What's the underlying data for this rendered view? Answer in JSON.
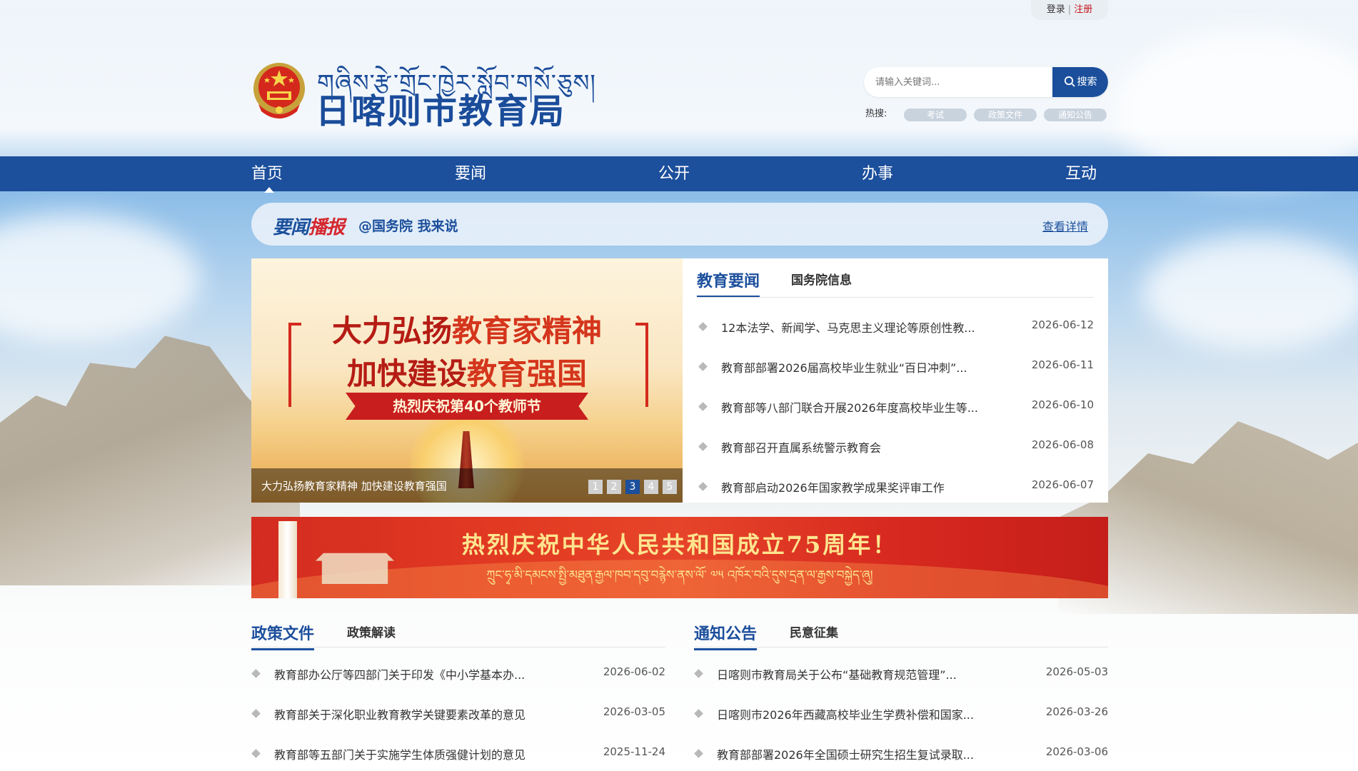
{
  "topbar": {
    "login": "登录",
    "separator": "|",
    "register": "注册"
  },
  "header": {
    "tibetan_name": "གཞིས་རྩེ་གྲོང་ཁྱེར་སློབ་གསོ་ཅུས།",
    "site_name": "日喀则市教育局",
    "search_placeholder": "请输入关键词...",
    "search_button": "搜索",
    "hot_label": "热搜:",
    "hot_tags": [
      "考试",
      "政策文件",
      "通知公告"
    ]
  },
  "nav": [
    "首页",
    "要闻",
    "公开",
    "办事",
    "互动"
  ],
  "ticker": {
    "logo_part1": "要闻",
    "logo_part2": "播报",
    "text": "@国务院 我来说",
    "more": "查看详情"
  },
  "slider": {
    "line1_a": "大力弘扬",
    "line1_b": "教育家精神",
    "line2_a": "加快建设",
    "line2_b": "教育强国",
    "ribbon": "热烈庆祝第40个教师节",
    "caption": "大力弘扬教育家精神 加快建设教育强国",
    "pages": [
      "1",
      "2",
      "3",
      "4",
      "5"
    ],
    "active_page": 3
  },
  "news_panel": {
    "tabs": [
      "教育要闻",
      "国务院信息"
    ],
    "items": [
      {
        "title": "12本法学、新闻学、马克思主义理论等原创性教...",
        "date": "2026-06-12"
      },
      {
        "title": "教育部部署2026届高校毕业生就业“百日冲刺”...",
        "date": "2026-06-11"
      },
      {
        "title": "教育部等八部门联合开展2026年度高校毕业生等...",
        "date": "2026-06-10"
      },
      {
        "title": "教育部召开直属系统警示教育会",
        "date": "2026-06-08"
      },
      {
        "title": "教育部启动2026年国家教学成果奖评审工作",
        "date": "2026-06-07"
      }
    ]
  },
  "banner": {
    "title": "热烈庆祝中华人民共和国成立75周年！",
    "tibetan": "ཀྲུང་ཧྭ་མི་དམངས་སྤྱི་མཐུན་རྒྱལ་ཁབ་དབུ་བརྙེས་ནས་ལོ་ ༧༥ འཁོར་བའི་དུས་དྲན་ལ་རྒྱས་བསྐྱེད་ཞུ།"
  },
  "policy_section": {
    "tabs": [
      "政策文件",
      "政策解读"
    ],
    "items": [
      {
        "title": "教育部办公厅等四部门关于印发《中小学基本办...",
        "date": "2026-06-02"
      },
      {
        "title": "教育部关于深化职业教育教学关键要素改革的意见",
        "date": "2026-03-05"
      },
      {
        "title": "教育部等五部门关于实施学生体质强健计划的意见",
        "date": "2025-11-24"
      }
    ]
  },
  "notice_section": {
    "tabs": [
      "通知公告",
      "民意征集"
    ],
    "items": [
      {
        "title": "日喀则市教育局关于公布“基础教育规范管理”...",
        "date": "2026-05-03"
      },
      {
        "title": "日喀则市2026年西藏高校毕业生学费补偿和国家...",
        "date": "2026-03-26"
      },
      {
        "title": "教育部部署2026年全国硕士研究生招生复试录取...",
        "date": "2026-03-06"
      }
    ]
  },
  "colors": {
    "primary": "#1c4f9c",
    "accent_red": "#c4161c",
    "banner_red": "#d32b20"
  }
}
